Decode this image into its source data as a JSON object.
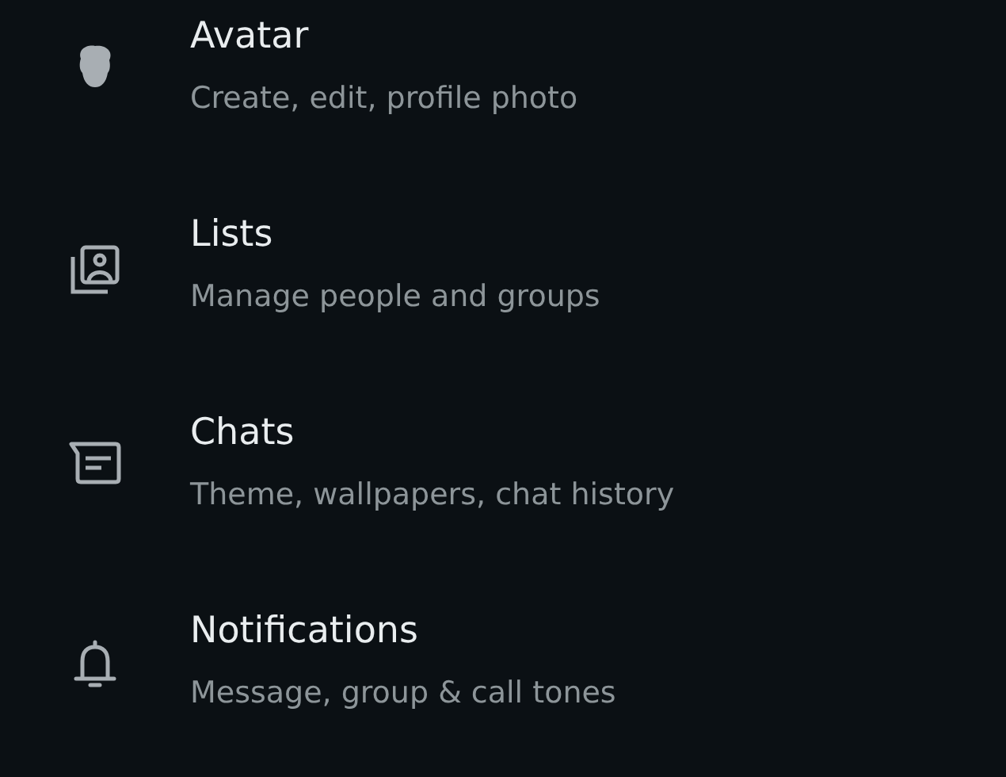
{
  "settings": [
    {
      "kind": "avatar",
      "title": "Avatar",
      "subtitle": "Create, edit, profile photo"
    },
    {
      "kind": "lists",
      "title": "Lists",
      "subtitle": "Manage people and groups"
    },
    {
      "kind": "chats",
      "title": "Chats",
      "subtitle": "Theme, wallpapers, chat history"
    },
    {
      "kind": "notifications",
      "title": "Notifications",
      "subtitle": "Message, group & call tones"
    }
  ]
}
